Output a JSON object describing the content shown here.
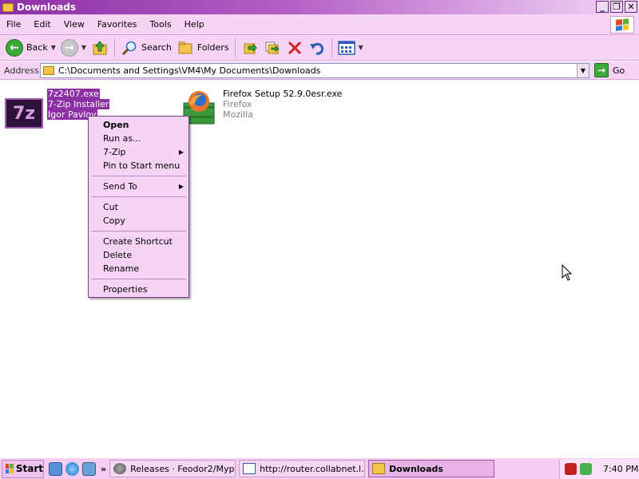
{
  "window": {
    "title": "Downloads",
    "controls": {
      "minimize": "_",
      "maximize": "❐",
      "close": "✕"
    }
  },
  "menubar": [
    "File",
    "Edit",
    "View",
    "Favorites",
    "Tools",
    "Help"
  ],
  "toolbar": {
    "back_label": "Back",
    "search_label": "Search",
    "folders_label": "Folders"
  },
  "address": {
    "label": "Address",
    "value": "C:\\Documents and Settings\\VM4\\My Documents\\Downloads",
    "go_label": "Go"
  },
  "files": [
    {
      "name": "7z2407.exe",
      "description": "7-Zip Installer",
      "company": "Igor Pavlov",
      "icon": "7zip-icon",
      "icon_text": "7z",
      "selected": true
    },
    {
      "name": "Firefox Setup 52.9.0esr.exe",
      "description": "Firefox",
      "company": "Mozilla",
      "icon": "firefox-installer-icon",
      "selected": false
    }
  ],
  "context_menu": {
    "items": [
      {
        "label": "Open",
        "bold": true
      },
      {
        "label": "Run as..."
      },
      {
        "label": "7-Zip",
        "submenu": true
      },
      {
        "label": "Pin to Start menu"
      },
      {
        "separator": true
      },
      {
        "label": "Send To",
        "submenu": true
      },
      {
        "separator": true
      },
      {
        "label": "Cut"
      },
      {
        "label": "Copy"
      },
      {
        "separator": true
      },
      {
        "label": "Create Shortcut"
      },
      {
        "label": "Delete"
      },
      {
        "label": "Rename"
      },
      {
        "separator": true
      },
      {
        "label": "Properties"
      }
    ]
  },
  "taskbar": {
    "start_label": "Start",
    "quicklaunch_more": "»",
    "tasks": [
      {
        "label": "Releases · Feodor2/Myp...",
        "icon": "browser-icon",
        "active": false
      },
      {
        "label": "http://router.collabnet.l...",
        "icon": "ie-icon",
        "active": false
      },
      {
        "label": "Downloads",
        "icon": "folder-icon",
        "active": true
      }
    ],
    "clock": "7:40 PM"
  },
  "colors": {
    "accent": "#8d2fa6",
    "chrome": "#f7d3f5",
    "selection": "#8d2fa6"
  }
}
